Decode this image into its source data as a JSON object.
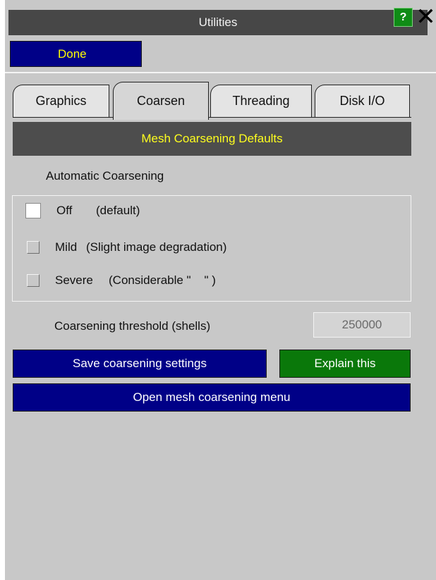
{
  "window": {
    "title": "Utilities",
    "help_label": "?",
    "close_icon": "close-icon"
  },
  "toolbar": {
    "done_label": "Done"
  },
  "tabs": [
    {
      "label": "Graphics",
      "active": false
    },
    {
      "label": "Coarsen",
      "active": true
    },
    {
      "label": "Threading",
      "active": false
    },
    {
      "label": "Disk I/O",
      "active": false
    }
  ],
  "section": {
    "title": "Mesh Coarsening Defaults"
  },
  "automatic_coarsening": {
    "label": "Automatic Coarsening",
    "options": [
      {
        "name": "Off",
        "note": "(default)",
        "checked": true
      },
      {
        "name": "Mild",
        "note": "(Slight image degradation)",
        "checked": false
      },
      {
        "name": "Severe",
        "note": "(Considerable \"    \" )",
        "checked": false
      }
    ]
  },
  "threshold": {
    "label": "Coarsening threshold (shells)",
    "value": "250000"
  },
  "buttons": {
    "save_label": "Save coarsening settings",
    "explain_label": "Explain this",
    "open_menu_label": "Open mesh coarsening menu"
  },
  "colors": {
    "panel_bg": "#c8c8c8",
    "title_bg": "#474747",
    "header_text": "#ffff1e",
    "button_blue": "#000087",
    "button_green": "#0a780a"
  }
}
